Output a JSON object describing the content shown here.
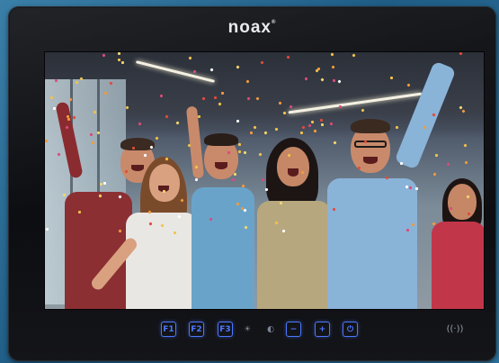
{
  "device": {
    "brand": "noax",
    "brand_mark": "®"
  },
  "screen": {
    "content": "photo"
  },
  "controls": {
    "f1": "F1",
    "f2": "F2",
    "f3": "F3",
    "brightness": "☀",
    "contrast": "◐",
    "minus": "−",
    "plus": "+",
    "power": "⏻",
    "nfc": "((·))"
  },
  "colors": {
    "accent": "#4d78ff",
    "bezel": "#111216",
    "background": "#2a6a95"
  }
}
